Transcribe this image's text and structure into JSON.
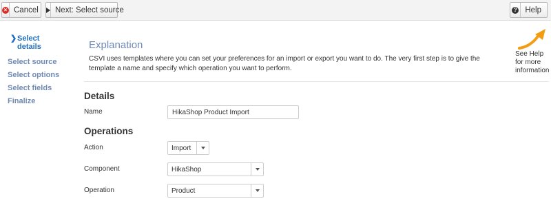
{
  "toolbar": {
    "cancel_label": "Cancel",
    "next_label": "Next: Select source",
    "help_label": "Help",
    "cancel_icon": "cancel-circle-icon",
    "next_icon": "play-icon",
    "help_icon": "question-circle-icon"
  },
  "sidebar": {
    "steps": [
      {
        "label": "Select details",
        "active": true
      },
      {
        "label": "Select source",
        "active": false
      },
      {
        "label": "Select options",
        "active": false
      },
      {
        "label": "Select fields",
        "active": false
      },
      {
        "label": "Finalize",
        "active": false
      }
    ],
    "active_color": "#1f6fbf",
    "inactive_color": "#6f8ab4"
  },
  "explanation": {
    "title": "Explanation",
    "text": "CSVI uses templates where you can set your preferences for an import or export you want to do. The very first step is to give the template a name and specify which operation you want to perform."
  },
  "help_hint": {
    "text": "See Help for more information",
    "arrow_color": "#f39c12"
  },
  "details": {
    "heading": "Details",
    "name_label": "Name",
    "name_value": "HikaShop Product Import"
  },
  "operations": {
    "heading": "Operations",
    "action_label": "Action",
    "action_value": "Import",
    "component_label": "Component",
    "component_value": "HikaShop",
    "operation_label": "Operation",
    "operation_value": "Product"
  }
}
